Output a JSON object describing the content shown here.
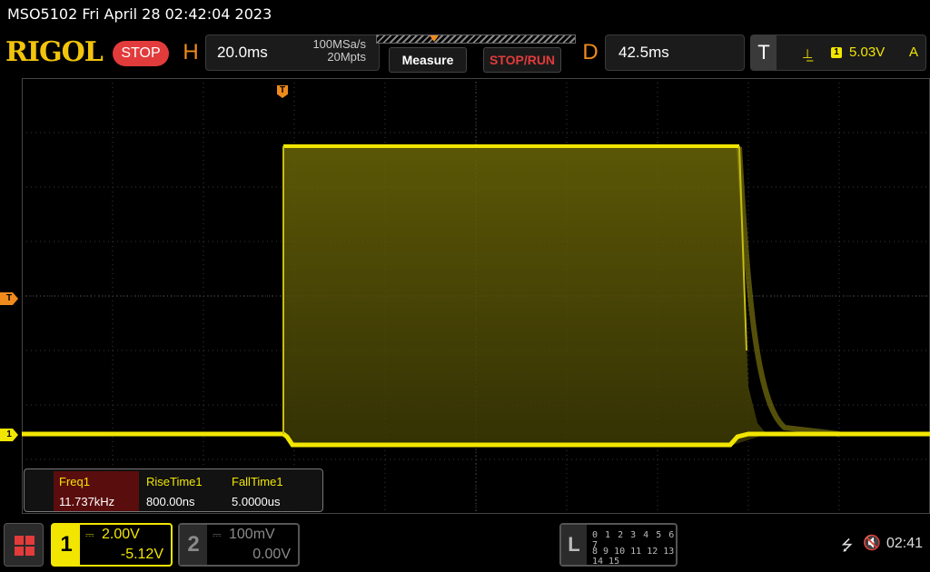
{
  "title_bar": {
    "text": "MSO5102  Fri April 28 02:42:04 2023"
  },
  "toolbar": {
    "logo": "RIGOL",
    "run_status": "STOP",
    "horizontal": {
      "letter": "H",
      "timebase": "20.0ms",
      "sample_rate": "100MSa/s",
      "memory_depth": "20Mpts"
    },
    "measure_label": "Measure",
    "stoprun_label": "STOP/RUN",
    "delay": {
      "letter": "D",
      "value": "42.5ms"
    },
    "trigger": {
      "letter": "T",
      "edge_icon": "rising-edge-icon",
      "channel": "1",
      "level": "5.03V",
      "mode": "A"
    }
  },
  "markers": {
    "trigger_position": "T",
    "trigger_level": "T",
    "ch1_offset": "1"
  },
  "measurements": [
    {
      "name": "Freq1",
      "value": "11.737kHz"
    },
    {
      "name": "RiseTime1",
      "value": "800.00ns"
    },
    {
      "name": "FallTime1",
      "value": "5.0000us"
    }
  ],
  "channels": {
    "ch1": {
      "num": "1",
      "scale": "2.00V",
      "offset": "-5.12V",
      "color": "#f2e600"
    },
    "ch2": {
      "num": "2",
      "scale": "100mV",
      "offset": "0.00V",
      "color": "#8a8a8a"
    }
  },
  "logic_analyzer": {
    "letter": "L",
    "row1": "0 1 2 3  4 5 6 7",
    "row2": "8 9 10 11 12 13 14 15"
  },
  "status": {
    "clock": "02:41"
  },
  "colors": {
    "accent_orange": "#f08a1c",
    "ch1_yellow": "#f2e600",
    "stop_red": "#e23b3b"
  }
}
